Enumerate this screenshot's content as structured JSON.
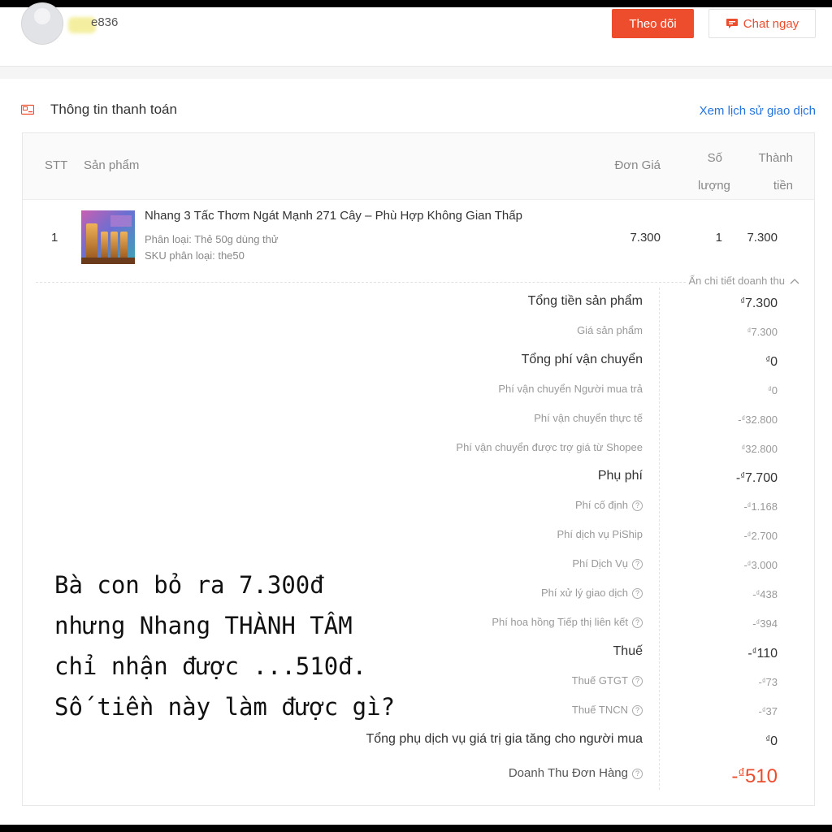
{
  "header": {
    "username": "e836",
    "follow_label": "Theo dõi",
    "chat_label": "Chat ngay"
  },
  "payment": {
    "section_title": "Thông tin thanh toán",
    "history_link": "Xem lịch sử giao dịch",
    "columns": {
      "stt": "STT",
      "product": "Sản phẩm",
      "unit_price": "Đơn Giá",
      "qty_line1": "Số",
      "qty_line2": "lượng",
      "total_line1": "Thành",
      "total_line2": "tiền"
    },
    "item": {
      "stt": "1",
      "name": "Nhang 3 Tấc Thơm Ngát Mạnh 271 Cây – Phù Hợp Không Gian Thấp",
      "variant": "Phân loại: Thẻ 50g dùng thử",
      "sku": "SKU phân loại: the50",
      "unit_price": "7.300",
      "qty": "1",
      "total": "7.300"
    },
    "toggle_details": "Ẩn chi tiết doanh thu",
    "currency": "₫",
    "breakdown": [
      {
        "label": "Tổng tiền sản phẩm",
        "sign": "",
        "amount": "7.300",
        "level": "main"
      },
      {
        "label": "Giá sản phẩm",
        "sign": "",
        "amount": "7.300",
        "level": "sub"
      },
      {
        "label": "Tổng phí vận chuyển",
        "sign": "",
        "amount": "0",
        "level": "main"
      },
      {
        "label": "Phí vận chuyển Người mua trả",
        "sign": "",
        "amount": "0",
        "level": "sub"
      },
      {
        "label": "Phí vận chuyển thực tế",
        "sign": "-",
        "amount": "32.800",
        "level": "sub"
      },
      {
        "label": "Phí vận chuyển được trợ giá từ Shopee",
        "sign": "",
        "amount": "32.800",
        "level": "sub"
      },
      {
        "label": "Phụ phí",
        "sign": "-",
        "amount": "7.700",
        "level": "main"
      },
      {
        "label": "Phí cố định",
        "sign": "-",
        "amount": "1.168",
        "level": "sub",
        "help": true
      },
      {
        "label": "Phí dịch vụ PiShip",
        "sign": "-",
        "amount": "2.700",
        "level": "sub"
      },
      {
        "label": "Phí Dịch Vụ",
        "sign": "-",
        "amount": "3.000",
        "level": "sub",
        "help": true
      },
      {
        "label": "Phí xử lý giao dịch",
        "sign": "-",
        "amount": "438",
        "level": "sub",
        "help": true
      },
      {
        "label": "Phí hoa hồng Tiếp thị liên kết",
        "sign": "-",
        "amount": "394",
        "level": "sub",
        "help": true
      },
      {
        "label": "Thuế",
        "sign": "-",
        "amount": "110",
        "level": "main"
      },
      {
        "label": "Thuế GTGT",
        "sign": "-",
        "amount": "73",
        "level": "sub",
        "help": true
      },
      {
        "label": "Thuế TNCN",
        "sign": "-",
        "amount": "37",
        "level": "sub",
        "help": true
      },
      {
        "label": "Tổng phụ dịch vụ giá trị gia tăng cho người mua",
        "sign": "",
        "amount": "0",
        "level": "main"
      },
      {
        "label": "Doanh Thu Đơn Hàng",
        "sign": "-",
        "amount": "510",
        "level": "revenue",
        "help": true
      }
    ]
  },
  "overlay": {
    "lines": [
      "Bà con bỏ ra 7.300đ",
      "nhưng Nhang THÀNH TÂM",
      "chỉ nhận được ...510đ.",
      "Số tiền này làm được gì?"
    ]
  },
  "colors": {
    "brand": "#ee4d2d",
    "link": "#2673dd"
  }
}
